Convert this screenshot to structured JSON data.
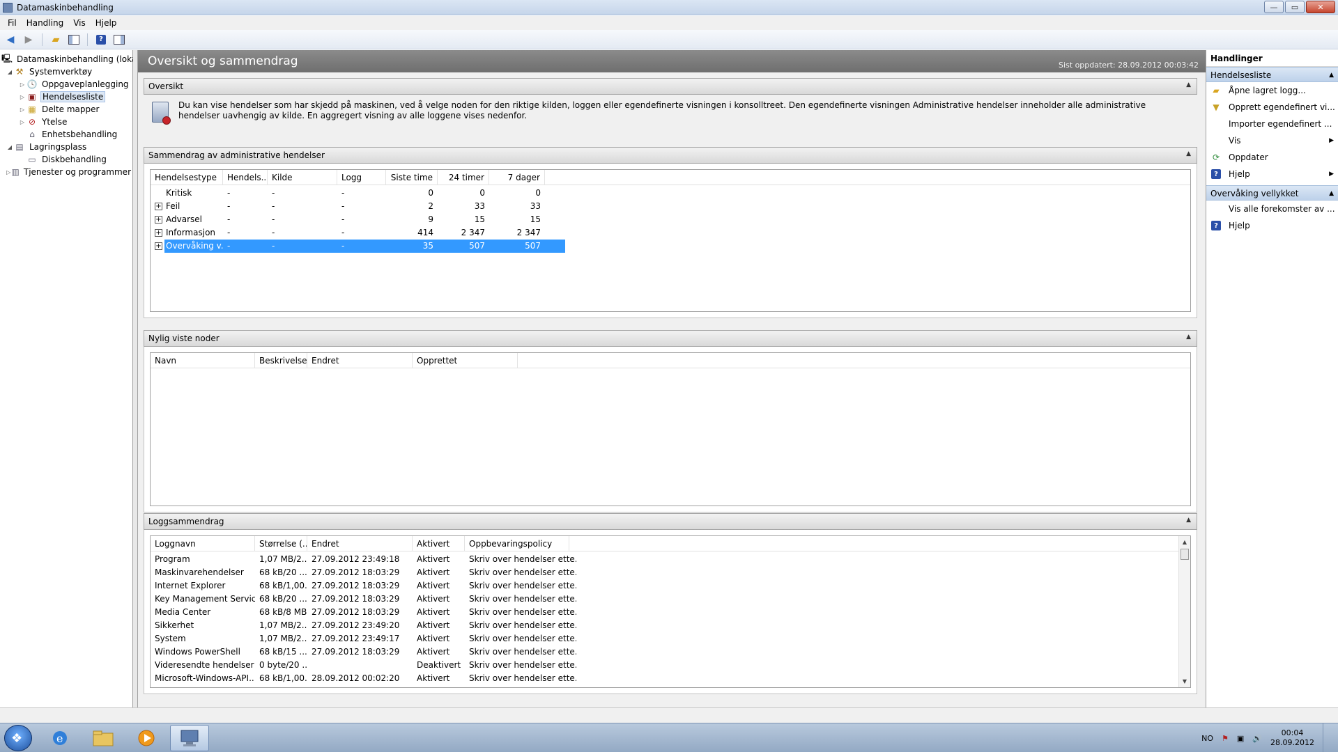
{
  "window": {
    "title": "Datamaskinbehandling",
    "buttons": {
      "minimize": "—",
      "maximize": "▭",
      "close": "✕"
    }
  },
  "menu": [
    "Fil",
    "Handling",
    "Vis",
    "Hjelp"
  ],
  "toolbar": {
    "icons": [
      "back-icon",
      "forward-icon",
      "folder-up-icon",
      "show-hide-tree-icon",
      "help-icon",
      "show-hide-actions-icon"
    ]
  },
  "tree": {
    "items": [
      {
        "label": "Datamaskinbehandling (lokal)",
        "expander": "",
        "icon": "computer-management-icon",
        "level": 0
      },
      {
        "label": "Systemverktøy",
        "expander": "◢",
        "icon": "system-tools-icon",
        "level": 1
      },
      {
        "label": "Oppgaveplanlegging",
        "expander": "▷",
        "icon": "task-scheduler-icon",
        "level": 2
      },
      {
        "label": "Hendelsesliste",
        "expander": "▷",
        "icon": "event-viewer-icon",
        "level": 2,
        "selected": true
      },
      {
        "label": "Delte mapper",
        "expander": "▷",
        "icon": "shared-folders-icon",
        "level": 2
      },
      {
        "label": "Ytelse",
        "expander": "▷",
        "icon": "performance-icon",
        "level": 2
      },
      {
        "label": "Enhetsbehandling",
        "expander": "",
        "icon": "device-manager-icon",
        "level": 2
      },
      {
        "label": "Lagringsplass",
        "expander": "◢",
        "icon": "storage-icon",
        "level": 1
      },
      {
        "label": "Diskbehandling",
        "expander": "",
        "icon": "disk-management-icon",
        "level": 2
      },
      {
        "label": "Tjenester og programmer",
        "expander": "▷",
        "icon": "services-icon",
        "level": 1
      }
    ]
  },
  "center": {
    "title": "Oversikt og sammendrag",
    "updated": "Sist oppdatert: 28.09.2012 00:03:42",
    "overview": {
      "header": "Oversikt",
      "text": "Du kan vise hendelser som har skjedd på maskinen, ved å velge noden for den riktige kilden, loggen eller egendefinerte visningen i konsolltreet. Den egendefinerte visningen Administrative hendelser inneholder alle administrative hendelser uavhengig av kilde. En aggregert visning av alle loggene vises nedenfor."
    },
    "admin_summary": {
      "header": "Sammendrag av administrative hendelser",
      "columns": [
        "Hendelsestype",
        "Hendels...",
        "Kilde",
        "Logg",
        "Siste time",
        "24 timer",
        "7 dager"
      ],
      "rows": [
        {
          "type": "Kritisk",
          "id": "-",
          "source": "-",
          "log": "-",
          "hour": "0",
          "day": "0",
          "week": "0",
          "expandable": false
        },
        {
          "type": "Feil",
          "id": "-",
          "source": "-",
          "log": "-",
          "hour": "2",
          "day": "33",
          "week": "33",
          "expandable": true
        },
        {
          "type": "Advarsel",
          "id": "-",
          "source": "-",
          "log": "-",
          "hour": "9",
          "day": "15",
          "week": "15",
          "expandable": true
        },
        {
          "type": "Informasjon",
          "id": "-",
          "source": "-",
          "log": "-",
          "hour": "414",
          "day": "2 347",
          "week": "2 347",
          "expandable": true
        },
        {
          "type": "Overvåking v...",
          "id": "-",
          "source": "-",
          "log": "-",
          "hour": "35",
          "day": "507",
          "week": "507",
          "expandable": true,
          "selected": true
        }
      ]
    },
    "recent_nodes": {
      "header": "Nylig viste noder",
      "columns": [
        "Navn",
        "Beskrivelse",
        "Endret",
        "Opprettet"
      ]
    },
    "log_summary": {
      "header": "Loggsammendrag",
      "columns": [
        "Loggnavn",
        "Størrelse (...",
        "Endret",
        "Aktivert",
        "Oppbevaringspolicy"
      ],
      "rows": [
        [
          "Program",
          "1,07 MB/2...",
          "27.09.2012 23:49:18",
          "Aktivert",
          "Skriv over hendelser ette..."
        ],
        [
          "Maskinvarehendelser",
          "68 kB/20 ...",
          "27.09.2012 18:03:29",
          "Aktivert",
          "Skriv over hendelser ette..."
        ],
        [
          "Internet Explorer",
          "68 kB/1,00...",
          "27.09.2012 18:03:29",
          "Aktivert",
          "Skriv over hendelser ette..."
        ],
        [
          "Key Management Service",
          "68 kB/20 ...",
          "27.09.2012 18:03:29",
          "Aktivert",
          "Skriv over hendelser ette..."
        ],
        [
          "Media Center",
          "68 kB/8 MB",
          "27.09.2012 18:03:29",
          "Aktivert",
          "Skriv over hendelser ette..."
        ],
        [
          "Sikkerhet",
          "1,07 MB/2...",
          "27.09.2012 23:49:20",
          "Aktivert",
          "Skriv over hendelser ette..."
        ],
        [
          "System",
          "1,07 MB/2...",
          "27.09.2012 23:49:17",
          "Aktivert",
          "Skriv over hendelser ette..."
        ],
        [
          "Windows PowerShell",
          "68 kB/15 ...",
          "27.09.2012 18:03:29",
          "Aktivert",
          "Skriv over hendelser ette..."
        ],
        [
          "Videresendte hendelser",
          "0 byte/20 ...",
          "",
          "Deaktivert",
          "Skriv over hendelser ette..."
        ],
        [
          "Microsoft-Windows-API...",
          "68 kB/1,00...",
          "28.09.2012 00:02:20",
          "Aktivert",
          "Skriv over hendelser ette..."
        ]
      ]
    }
  },
  "actions": {
    "title": "Handlinger",
    "sections": [
      {
        "header": "Hendelsesliste",
        "items": [
          {
            "label": "Åpne lagret logg...",
            "icon": "open-folder-icon",
            "submenu": false
          },
          {
            "label": "Opprett egendefinert vi...",
            "icon": "filter-icon",
            "submenu": false
          },
          {
            "label": "Importer egendefinert ...",
            "icon": "",
            "submenu": false
          },
          {
            "label": "Vis",
            "icon": "",
            "submenu": true
          },
          {
            "label": "Oppdater",
            "icon": "refresh-icon",
            "submenu": false
          },
          {
            "label": "Hjelp",
            "icon": "help-icon",
            "submenu": true
          }
        ]
      },
      {
        "header": "Overvåking vellykket",
        "items": [
          {
            "label": "Vis alle forekomster av ...",
            "icon": "",
            "submenu": false
          },
          {
            "label": "Hjelp",
            "icon": "help-icon",
            "submenu": false
          }
        ]
      }
    ]
  },
  "taskbar": {
    "apps": [
      "internet-explorer-icon",
      "windows-explorer-icon",
      "media-player-icon",
      "computer-management-taskbar-icon"
    ],
    "language": "NO",
    "time": "00:04",
    "date": "28.09.2012"
  },
  "colors": {
    "selection": "#3399ff",
    "header_gray": "#7a7a7a",
    "action_section": "#c9dbef"
  }
}
